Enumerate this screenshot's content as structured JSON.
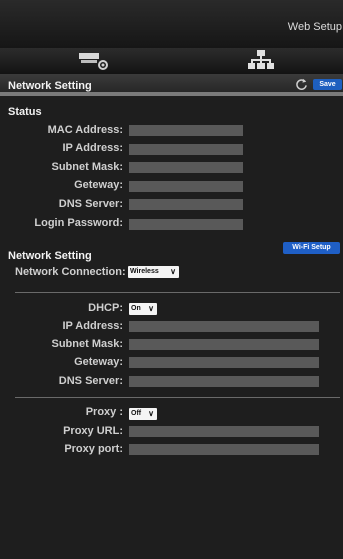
{
  "top": {
    "web_title": "Web Setup"
  },
  "icons": {
    "tool": "tool-settings-icon",
    "network": "network-tree-icon",
    "refresh": "refresh-icon"
  },
  "header": {
    "title": "Network Setting",
    "save_label": "Save"
  },
  "status": {
    "title": "Status",
    "labels": {
      "mac": "MAC Address:",
      "ip": "IP Address:",
      "subnet": "Subnet Mask:",
      "gateway": "Geteway:",
      "dns": "DNS Server:",
      "login": "Login Password:"
    }
  },
  "network": {
    "title": "Network Setting",
    "wifi_label": "Wi-Fi Setup",
    "connection_label": "Network Connection:",
    "connection_value": "Wireless"
  },
  "dhcp": {
    "label": "DHCP:",
    "value": "On",
    "labels": {
      "ip": "IP Address:",
      "subnet": "Subnet Mask:",
      "gateway": "Geteway:",
      "dns": "DNS Server:"
    }
  },
  "proxy": {
    "label": "Proxy :",
    "value": "Off",
    "url_label": "Proxy URL:",
    "port_label": "Proxy port:"
  },
  "colors": {
    "accent": "#1e5fbf",
    "field": "#595959",
    "background": "#1e1e1e"
  }
}
